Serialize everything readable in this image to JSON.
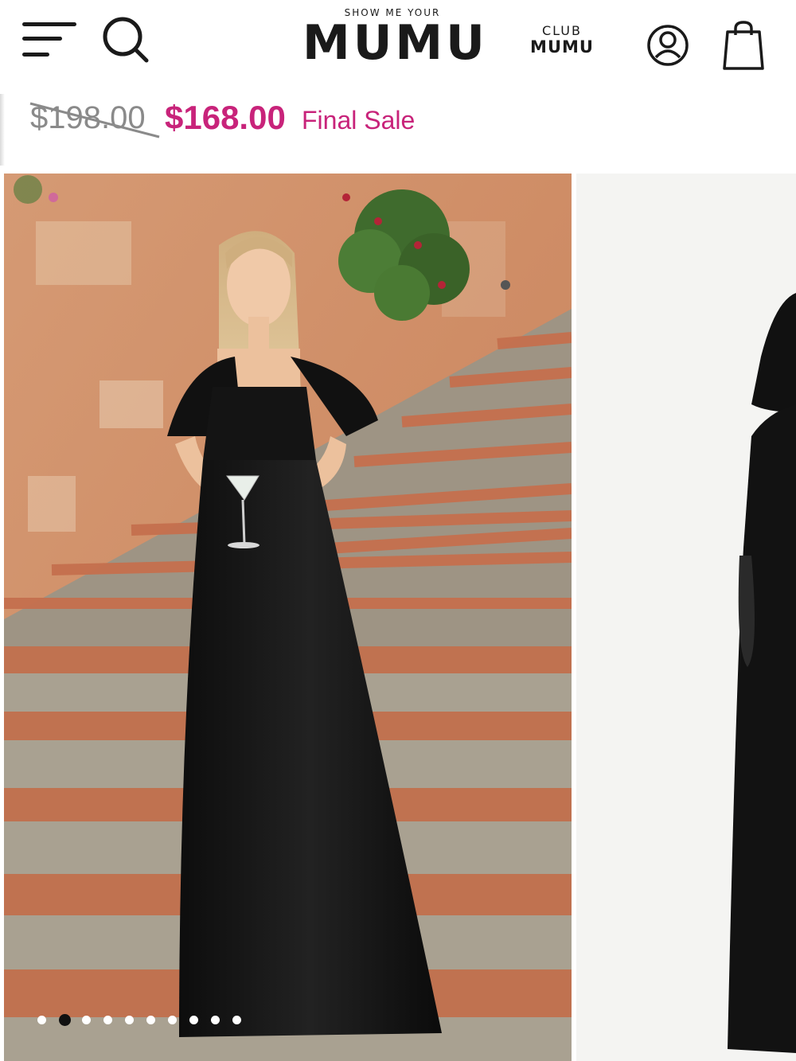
{
  "header": {
    "logo_small": "SHOW ME YOUR",
    "logo_big": "MUMU",
    "club_top": "CLUB",
    "club_bottom": "MUMU",
    "icons": [
      "menu-icon",
      "search-icon",
      "account-icon",
      "shopping-bag-icon"
    ]
  },
  "product": {
    "old_price": "$198.00",
    "price": "$168.00",
    "sale_label": "Final Sale"
  },
  "gallery": {
    "image_count": 10,
    "active_index": 1
  },
  "colors": {
    "accent": "#c8237a",
    "text": "#1a1a1a",
    "muted": "#8a8a8a"
  }
}
